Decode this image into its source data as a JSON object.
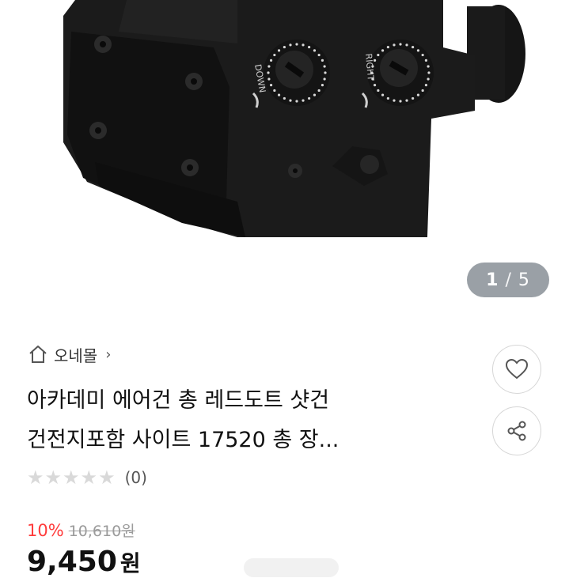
{
  "gallery": {
    "current": "1",
    "separator": "/",
    "total": "5"
  },
  "dials": {
    "left_label": "DOWN",
    "right_label": "RIGHT"
  },
  "store": {
    "name": "오네몰",
    "chevron": "›"
  },
  "product": {
    "title_line1": "아카데미 에어건 총 레드도트 샷건",
    "title_line2": "건전지포함 사이트 17520 총 장..."
  },
  "rating": {
    "stars": [
      "★",
      "★",
      "★",
      "★",
      "★"
    ],
    "count": "(0)"
  },
  "price": {
    "discount": "10%",
    "original": "10,610원",
    "final_amount": "9,450",
    "final_unit": "원"
  },
  "icons": [
    "home-icon",
    "heart-icon",
    "share-icon",
    "star-icon"
  ],
  "colors": {
    "discount": "#ff3b3b",
    "counter_bg": "#9aa0a6",
    "star": "#d9d9d9"
  }
}
